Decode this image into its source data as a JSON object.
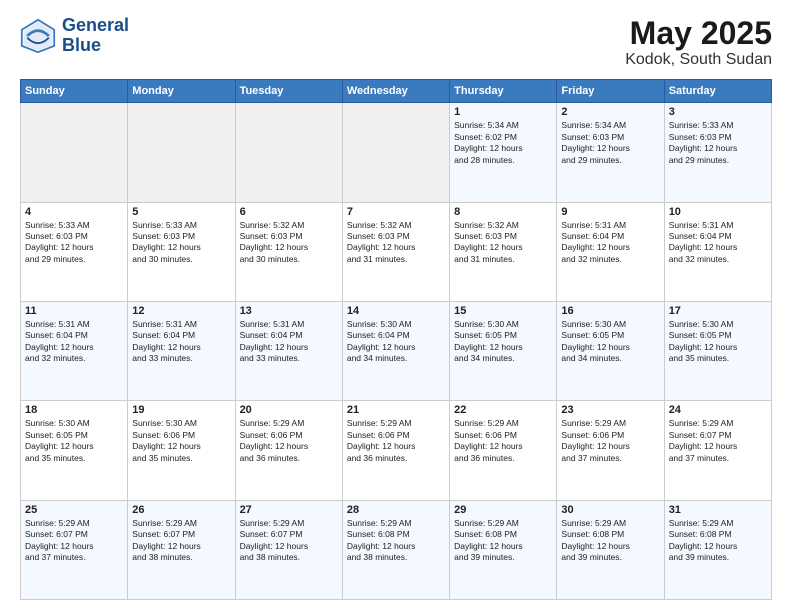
{
  "logo": {
    "line1": "General",
    "line2": "Blue"
  },
  "calendar": {
    "title": "May 2025",
    "subtitle": "Kodok, South Sudan",
    "days_of_week": [
      "Sunday",
      "Monday",
      "Tuesday",
      "Wednesday",
      "Thursday",
      "Friday",
      "Saturday"
    ],
    "weeks": [
      [
        {
          "day": "",
          "info": ""
        },
        {
          "day": "",
          "info": ""
        },
        {
          "day": "",
          "info": ""
        },
        {
          "day": "",
          "info": ""
        },
        {
          "day": "1",
          "info": "Sunrise: 5:34 AM\nSunset: 6:02 PM\nDaylight: 12 hours\nand 28 minutes."
        },
        {
          "day": "2",
          "info": "Sunrise: 5:34 AM\nSunset: 6:03 PM\nDaylight: 12 hours\nand 29 minutes."
        },
        {
          "day": "3",
          "info": "Sunrise: 5:33 AM\nSunset: 6:03 PM\nDaylight: 12 hours\nand 29 minutes."
        }
      ],
      [
        {
          "day": "4",
          "info": "Sunrise: 5:33 AM\nSunset: 6:03 PM\nDaylight: 12 hours\nand 29 minutes."
        },
        {
          "day": "5",
          "info": "Sunrise: 5:33 AM\nSunset: 6:03 PM\nDaylight: 12 hours\nand 30 minutes."
        },
        {
          "day": "6",
          "info": "Sunrise: 5:32 AM\nSunset: 6:03 PM\nDaylight: 12 hours\nand 30 minutes."
        },
        {
          "day": "7",
          "info": "Sunrise: 5:32 AM\nSunset: 6:03 PM\nDaylight: 12 hours\nand 31 minutes."
        },
        {
          "day": "8",
          "info": "Sunrise: 5:32 AM\nSunset: 6:03 PM\nDaylight: 12 hours\nand 31 minutes."
        },
        {
          "day": "9",
          "info": "Sunrise: 5:31 AM\nSunset: 6:04 PM\nDaylight: 12 hours\nand 32 minutes."
        },
        {
          "day": "10",
          "info": "Sunrise: 5:31 AM\nSunset: 6:04 PM\nDaylight: 12 hours\nand 32 minutes."
        }
      ],
      [
        {
          "day": "11",
          "info": "Sunrise: 5:31 AM\nSunset: 6:04 PM\nDaylight: 12 hours\nand 32 minutes."
        },
        {
          "day": "12",
          "info": "Sunrise: 5:31 AM\nSunset: 6:04 PM\nDaylight: 12 hours\nand 33 minutes."
        },
        {
          "day": "13",
          "info": "Sunrise: 5:31 AM\nSunset: 6:04 PM\nDaylight: 12 hours\nand 33 minutes."
        },
        {
          "day": "14",
          "info": "Sunrise: 5:30 AM\nSunset: 6:04 PM\nDaylight: 12 hours\nand 34 minutes."
        },
        {
          "day": "15",
          "info": "Sunrise: 5:30 AM\nSunset: 6:05 PM\nDaylight: 12 hours\nand 34 minutes."
        },
        {
          "day": "16",
          "info": "Sunrise: 5:30 AM\nSunset: 6:05 PM\nDaylight: 12 hours\nand 34 minutes."
        },
        {
          "day": "17",
          "info": "Sunrise: 5:30 AM\nSunset: 6:05 PM\nDaylight: 12 hours\nand 35 minutes."
        }
      ],
      [
        {
          "day": "18",
          "info": "Sunrise: 5:30 AM\nSunset: 6:05 PM\nDaylight: 12 hours\nand 35 minutes."
        },
        {
          "day": "19",
          "info": "Sunrise: 5:30 AM\nSunset: 6:06 PM\nDaylight: 12 hours\nand 35 minutes."
        },
        {
          "day": "20",
          "info": "Sunrise: 5:29 AM\nSunset: 6:06 PM\nDaylight: 12 hours\nand 36 minutes."
        },
        {
          "day": "21",
          "info": "Sunrise: 5:29 AM\nSunset: 6:06 PM\nDaylight: 12 hours\nand 36 minutes."
        },
        {
          "day": "22",
          "info": "Sunrise: 5:29 AM\nSunset: 6:06 PM\nDaylight: 12 hours\nand 36 minutes."
        },
        {
          "day": "23",
          "info": "Sunrise: 5:29 AM\nSunset: 6:06 PM\nDaylight: 12 hours\nand 37 minutes."
        },
        {
          "day": "24",
          "info": "Sunrise: 5:29 AM\nSunset: 6:07 PM\nDaylight: 12 hours\nand 37 minutes."
        }
      ],
      [
        {
          "day": "25",
          "info": "Sunrise: 5:29 AM\nSunset: 6:07 PM\nDaylight: 12 hours\nand 37 minutes."
        },
        {
          "day": "26",
          "info": "Sunrise: 5:29 AM\nSunset: 6:07 PM\nDaylight: 12 hours\nand 38 minutes."
        },
        {
          "day": "27",
          "info": "Sunrise: 5:29 AM\nSunset: 6:07 PM\nDaylight: 12 hours\nand 38 minutes."
        },
        {
          "day": "28",
          "info": "Sunrise: 5:29 AM\nSunset: 6:08 PM\nDaylight: 12 hours\nand 38 minutes."
        },
        {
          "day": "29",
          "info": "Sunrise: 5:29 AM\nSunset: 6:08 PM\nDaylight: 12 hours\nand 39 minutes."
        },
        {
          "day": "30",
          "info": "Sunrise: 5:29 AM\nSunset: 6:08 PM\nDaylight: 12 hours\nand 39 minutes."
        },
        {
          "day": "31",
          "info": "Sunrise: 5:29 AM\nSunset: 6:08 PM\nDaylight: 12 hours\nand 39 minutes."
        }
      ]
    ]
  }
}
